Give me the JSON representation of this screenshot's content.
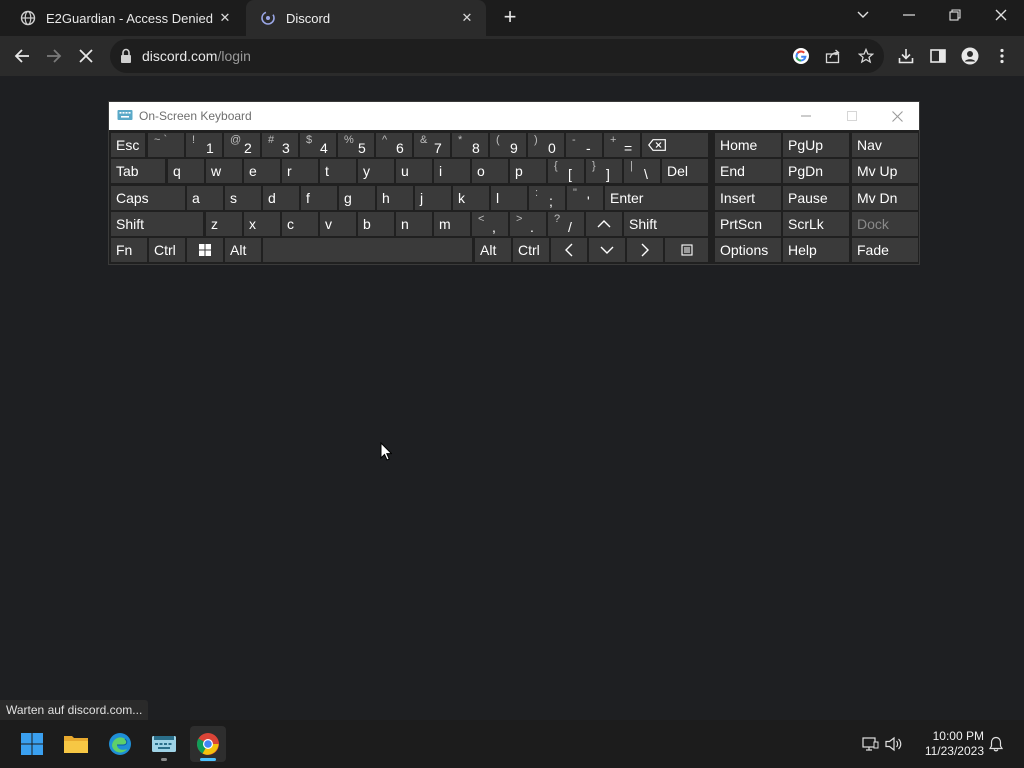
{
  "browser": {
    "tabs": [
      {
        "title": "E2Guardian - Access Denied",
        "icon": "globe-icon",
        "active": false
      },
      {
        "title": "Discord",
        "icon": "discord-icon",
        "active": true
      }
    ],
    "url_host": "discord.com",
    "url_path": "/login",
    "status": "Warten auf discord.com..."
  },
  "osk": {
    "title": "On-Screen Keyboard",
    "row1": {
      "esc": "Esc",
      "num": [
        {
          "s": "~ `",
          "m": ""
        },
        {
          "s": "!",
          "m": "1"
        },
        {
          "s": "@",
          "m": "2"
        },
        {
          "s": "#",
          "m": "3"
        },
        {
          "s": "$",
          "m": "4"
        },
        {
          "s": "%",
          "m": "5"
        },
        {
          "s": "^",
          "m": "6"
        },
        {
          "s": "&",
          "m": "7"
        },
        {
          "s": "*",
          "m": "8"
        },
        {
          "s": "(",
          "m": "9"
        },
        {
          "s": ")",
          "m": "0"
        },
        {
          "s": "-",
          "m": "-"
        },
        {
          "s": "+",
          "m": "="
        }
      ]
    },
    "row2": {
      "tab": "Tab",
      "letters": [
        "q",
        "w",
        "e",
        "r",
        "t",
        "y",
        "u",
        "i",
        "o",
        "p"
      ],
      "brackets": [
        {
          "s": "{",
          "m": "["
        },
        {
          "s": "}",
          "m": "]"
        },
        {
          "s": "|",
          "m": "\\"
        }
      ],
      "del": "Del"
    },
    "row3": {
      "caps": "Caps",
      "letters": [
        "a",
        "s",
        "d",
        "f",
        "g",
        "h",
        "j",
        "k",
        "l"
      ],
      "punct": [
        {
          "s": ":",
          "m": ";"
        },
        {
          "s": "\"",
          "m": "'"
        }
      ],
      "enter": "Enter"
    },
    "row4": {
      "shift": "Shift",
      "letters": [
        "z",
        "x",
        "c",
        "v",
        "b",
        "n",
        "m"
      ],
      "punct": [
        {
          "s": "<",
          "m": ","
        },
        {
          "s": ">",
          "m": "."
        },
        {
          "s": "?",
          "m": "/"
        }
      ],
      "shift_r": "Shift"
    },
    "row5": {
      "fn": "Fn",
      "ctrl": "Ctrl",
      "alt": "Alt",
      "alt_r": "Alt",
      "ctrl_r": "Ctrl"
    },
    "nav": {
      "col1": [
        "Home",
        "End",
        "Insert",
        "PrtScn",
        "Options"
      ],
      "col2": [
        "PgUp",
        "PgDn",
        "Pause",
        "ScrLk",
        "Help"
      ],
      "col3": [
        "Nav",
        "Mv Up",
        "Mv Dn",
        "Dock",
        "Fade"
      ]
    }
  },
  "taskbar": {
    "apps": [
      "windows-start-icon",
      "file-explorer-icon",
      "edge-icon",
      "on-screen-keyboard-icon",
      "chrome-icon"
    ],
    "time": "10:00 PM",
    "date": "11/23/2023"
  }
}
